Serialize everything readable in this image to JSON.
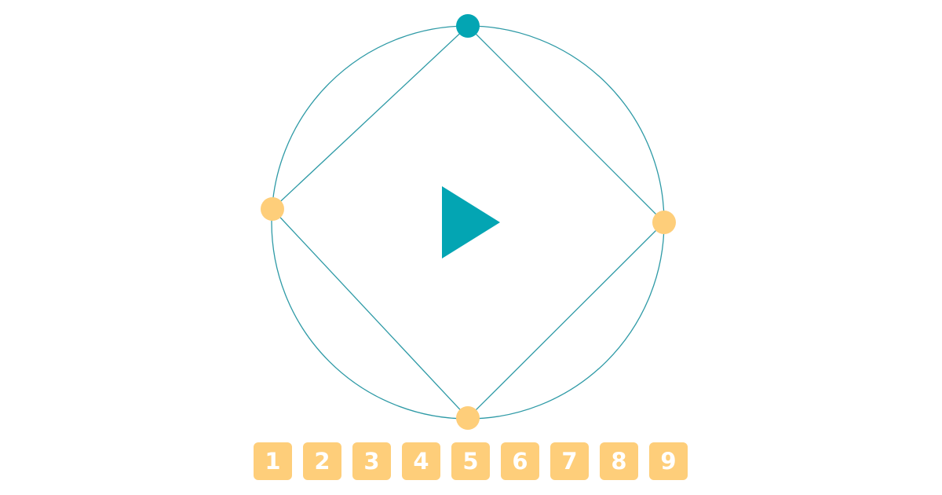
{
  "colors": {
    "teal": "#03a5b3",
    "peach": "#fece7a",
    "ring": "#2e9aa6",
    "background": "#ffffff"
  },
  "play": {
    "icon": "play-icon"
  },
  "nodes": [
    {
      "name": "top",
      "state": "active"
    },
    {
      "name": "right",
      "state": "inactive"
    },
    {
      "name": "bottom",
      "state": "inactive"
    },
    {
      "name": "left",
      "state": "inactive"
    }
  ],
  "number_buttons": [
    {
      "label": "1"
    },
    {
      "label": "2"
    },
    {
      "label": "3"
    },
    {
      "label": "4"
    },
    {
      "label": "5"
    },
    {
      "label": "6"
    },
    {
      "label": "7"
    },
    {
      "label": "8"
    },
    {
      "label": "9"
    }
  ]
}
